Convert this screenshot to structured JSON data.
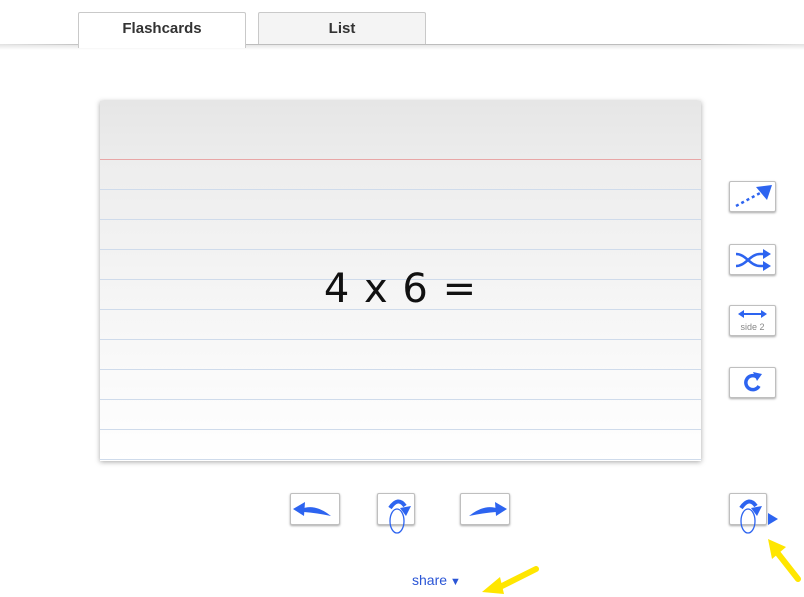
{
  "tabs": [
    {
      "label": "Flashcards",
      "active": true
    },
    {
      "label": "List",
      "active": false
    }
  ],
  "card": {
    "term": "4 x 6 ="
  },
  "side_buttons": {
    "side2_label": "side 2"
  },
  "share": {
    "label": "share",
    "caret": "▼"
  },
  "colors": {
    "accent_blue": "#2d64f0",
    "annotation_yellow": "#ffe600",
    "red_margin": "#e8a6a6",
    "ruled_line": "#cfdbeb"
  },
  "icons": [
    "export-icon",
    "shuffle-icon",
    "swap-sides-icon",
    "refresh-icon",
    "previous-arrow-icon",
    "flip-icon",
    "next-arrow-icon",
    "flip-and-next-icon",
    "annotation-arrow-icon"
  ]
}
